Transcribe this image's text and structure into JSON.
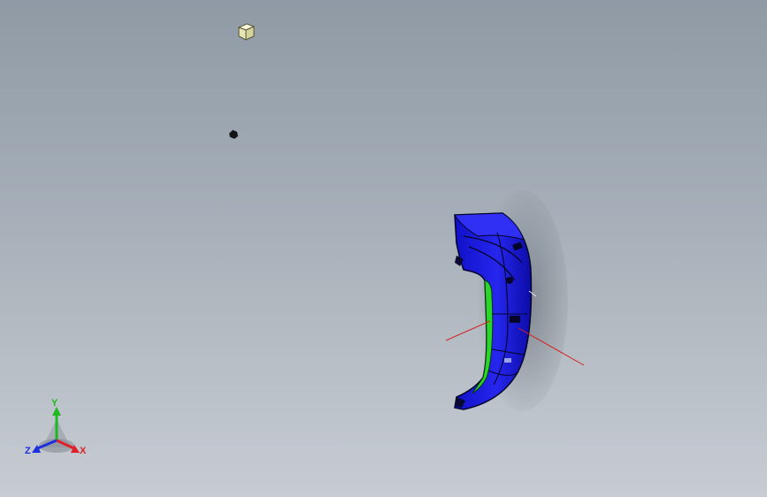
{
  "triad": {
    "y_label": "Y",
    "x_label": "X",
    "z_label": "Z"
  },
  "icons": {
    "view_cube": "view-cube-icon",
    "origin_marker": "origin-marker-icon",
    "triad": "coordinate-triad-icon"
  },
  "colors": {
    "background_top": "#8f9aa5",
    "background_bottom": "#c7ccd2",
    "part_body": "#1414d6",
    "part_highlight": "#2a2af0",
    "inner_face": "#2bd62b",
    "axis_x": "#e0202a",
    "axis_y": "#1fb81f",
    "axis_z": "#1f2fe0",
    "cube": "#f0f0c0",
    "reference_line": "#d42020"
  }
}
